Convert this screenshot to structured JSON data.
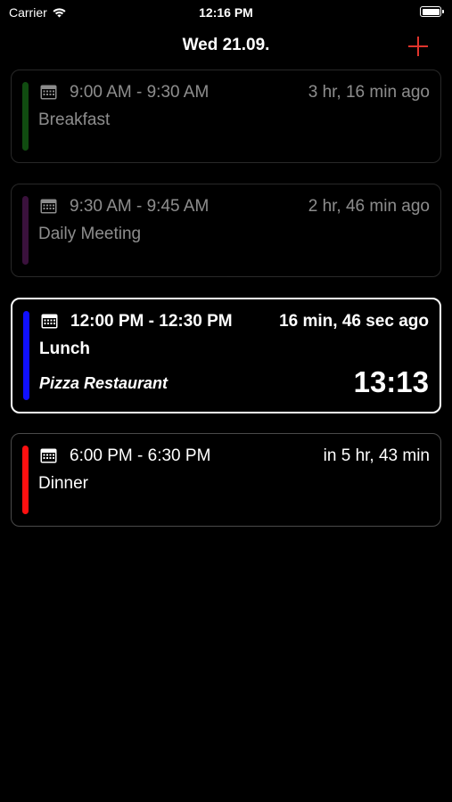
{
  "status_bar": {
    "carrier": "Carrier",
    "time": "12:16 PM",
    "wifi_icon": "wifi-icon",
    "battery_icon": "battery-icon"
  },
  "nav": {
    "title": "Wed 21.09.",
    "add_icon": "plus-icon",
    "accent_color": "#e0342c"
  },
  "events": [
    {
      "timerange": "9:00 AM - 9:30 AM",
      "relative": "3 hr, 16 min ago",
      "title": "Breakfast",
      "color": "#1e8a1e",
      "state": "past"
    },
    {
      "timerange": "9:30 AM - 9:45 AM",
      "relative": "2 hr, 46 min ago",
      "title": "Daily Meeting",
      "color": "#6a1f6e",
      "state": "past"
    },
    {
      "timerange": "12:00 PM - 12:30 PM",
      "relative": "16 min, 46 sec ago",
      "title": "Lunch",
      "location": "Pizza Restaurant",
      "countdown": "13:13",
      "color": "#1010ff",
      "state": "current"
    },
    {
      "timerange": "6:00 PM - 6:30 PM",
      "relative": "in 5 hr, 43 min",
      "title": "Dinner",
      "color": "#ff1010",
      "state": "upcoming"
    }
  ]
}
